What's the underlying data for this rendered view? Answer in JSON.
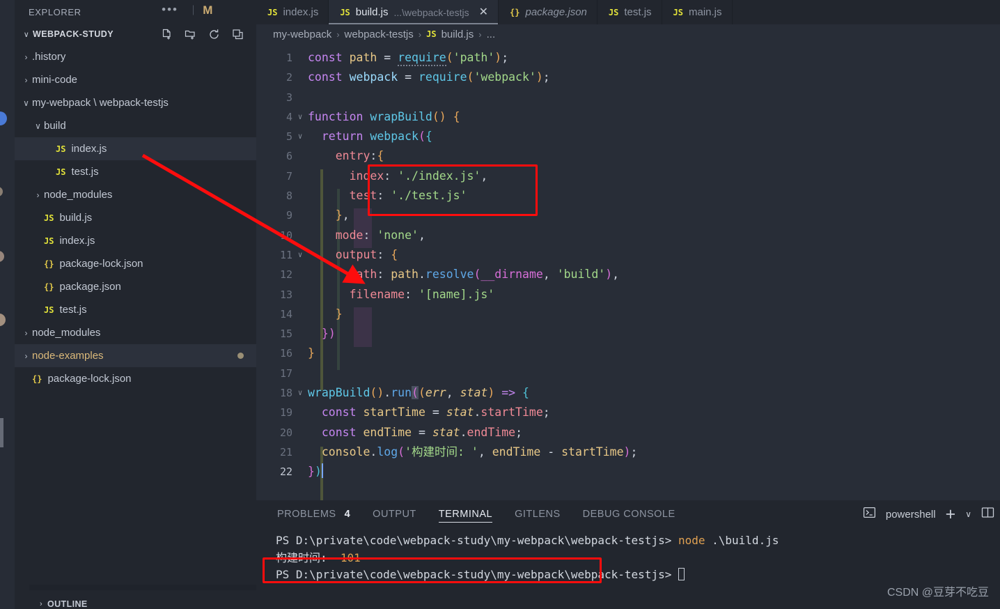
{
  "sidebar": {
    "title": "EXPLORER",
    "more_icon": "ellipsis-icon",
    "git_badge": "M",
    "section": {
      "label": "WEBPACK-STUDY",
      "chevron": "∨",
      "actions": [
        "new-file-icon",
        "new-folder-icon",
        "refresh-icon",
        "collapse-all-icon"
      ]
    },
    "tree": [
      {
        "label": ".history",
        "indent": 1,
        "chevron": "›",
        "icon": "",
        "type": "folder"
      },
      {
        "label": "mini-code",
        "indent": 1,
        "chevron": "›",
        "icon": "",
        "type": "folder"
      },
      {
        "label": "my-webpack \\ webpack-testjs",
        "indent": 1,
        "chevron": "∨",
        "icon": "",
        "type": "folder"
      },
      {
        "label": "build",
        "indent": 2,
        "chevron": "∨",
        "icon": "",
        "type": "folder"
      },
      {
        "label": "index.js",
        "indent": 3,
        "chevron": "",
        "icon": "JS",
        "type": "js",
        "selected": true
      },
      {
        "label": "test.js",
        "indent": 3,
        "chevron": "",
        "icon": "JS",
        "type": "js"
      },
      {
        "label": "node_modules",
        "indent": 2,
        "chevron": "›",
        "icon": "",
        "type": "folder"
      },
      {
        "label": "build.js",
        "indent": 2,
        "chevron": "",
        "icon": "JS",
        "type": "js"
      },
      {
        "label": "index.js",
        "indent": 2,
        "chevron": "",
        "icon": "JS",
        "type": "js"
      },
      {
        "label": "package-lock.json",
        "indent": 2,
        "chevron": "",
        "icon": "{}",
        "type": "json"
      },
      {
        "label": "package.json",
        "indent": 2,
        "chevron": "",
        "icon": "{}",
        "type": "json"
      },
      {
        "label": "test.js",
        "indent": 2,
        "chevron": "",
        "icon": "JS",
        "type": "js"
      },
      {
        "label": "node_modules",
        "indent": 1,
        "chevron": "›",
        "icon": "",
        "type": "folder"
      },
      {
        "label": "node-examples",
        "indent": 1,
        "chevron": "›",
        "icon": "",
        "type": "folder",
        "selected": true,
        "amber": true,
        "dirty": true
      },
      {
        "label": "package-lock.json",
        "indent": 1,
        "chevron": "",
        "icon": "{}",
        "type": "json"
      }
    ],
    "outline_label": "OUTLINE",
    "outline_chevron": "›"
  },
  "tabs": [
    {
      "icon": "JS",
      "name": "index.js",
      "suffix": "",
      "active": false,
      "italic": false,
      "closable": false
    },
    {
      "icon": "JS",
      "name": "build.js",
      "suffix": "...\\webpack-testjs",
      "active": true,
      "italic": false,
      "closable": true
    },
    {
      "icon": "{}",
      "name": "package.json",
      "suffix": "",
      "active": false,
      "italic": true,
      "closable": false
    },
    {
      "icon": "JS",
      "name": "test.js",
      "suffix": "",
      "active": false,
      "italic": false,
      "closable": false
    },
    {
      "icon": "JS",
      "name": "main.js",
      "suffix": "",
      "active": false,
      "italic": false,
      "closable": false
    }
  ],
  "breadcrumb": {
    "items": [
      "my-webpack",
      "webpack-testjs",
      "build.js",
      "..."
    ],
    "file_icon": "JS",
    "separator": "›"
  },
  "editor": {
    "filename": "build.js",
    "total_lines": 22,
    "cursor_line": 22,
    "lines": [
      {
        "n": 1,
        "text": "const path = require('path');"
      },
      {
        "n": 2,
        "text": "const webpack = require('webpack');"
      },
      {
        "n": 3,
        "text": ""
      },
      {
        "n": 4,
        "text": "function wrapBuild() {"
      },
      {
        "n": 5,
        "text": "  return webpack({"
      },
      {
        "n": 6,
        "text": "    entry:{"
      },
      {
        "n": 7,
        "text": "      index: './index.js',"
      },
      {
        "n": 8,
        "text": "      test: './test.js'"
      },
      {
        "n": 9,
        "text": "    },"
      },
      {
        "n": 10,
        "text": "    mode: 'none',"
      },
      {
        "n": 11,
        "text": "    output: {"
      },
      {
        "n": 12,
        "text": "      path: path.resolve(__dirname, 'build'),"
      },
      {
        "n": 13,
        "text": "      filename: '[name].js'"
      },
      {
        "n": 14,
        "text": "    }"
      },
      {
        "n": 15,
        "text": "  })"
      },
      {
        "n": 16,
        "text": "}"
      },
      {
        "n": 17,
        "text": ""
      },
      {
        "n": 18,
        "text": "wrapBuild().run((err, stat) => {"
      },
      {
        "n": 19,
        "text": "  const startTime = stat.startTime;"
      },
      {
        "n": 20,
        "text": "  const endTime = stat.endTime;"
      },
      {
        "n": 21,
        "text": "  console.log('构建时间: ', endTime - startTime);"
      },
      {
        "n": 22,
        "text": "})"
      }
    ]
  },
  "panel": {
    "tabs": [
      {
        "label": "PROBLEMS",
        "count": "4",
        "active": false
      },
      {
        "label": "OUTPUT",
        "count": "",
        "active": false
      },
      {
        "label": "TERMINAL",
        "count": "",
        "active": true
      },
      {
        "label": "GITLENS",
        "count": "",
        "active": false
      },
      {
        "label": "DEBUG CONSOLE",
        "count": "",
        "active": false
      }
    ],
    "shell": "powershell",
    "shell_icon": "terminal-icon",
    "add_icon": "+",
    "dropdown_icon": "∨",
    "split_icon": "split-terminal-icon",
    "terminal_lines": [
      {
        "prompt": "PS D:\\private\\code\\webpack-study\\my-webpack\\webpack-testjs> ",
        "cmd": "node",
        "arg": " .\\build.js"
      },
      {
        "prompt": "构建时间:  ",
        "cmd": "",
        "arg": "",
        "num": "101"
      },
      {
        "prompt": "PS D:\\private\\code\\webpack-study\\my-webpack\\webpack-testjs> ",
        "cmd": "",
        "arg": "",
        "caret": true
      }
    ]
  },
  "annotations": {
    "color": "#fd0d0d",
    "box_entry_label": "entry-object-highlight",
    "box_terminal_label": "build-time-output-highlight",
    "arrow_label": "pointer-from-index-js-to-output-path"
  },
  "watermark": "CSDN @豆芽不吃豆"
}
